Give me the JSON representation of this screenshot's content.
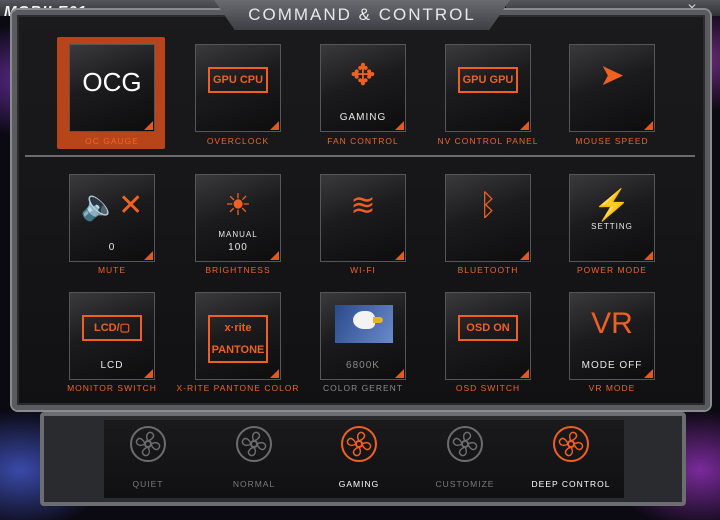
{
  "window": {
    "title": "COMMAND & CONTROL",
    "watermark": "MOBILE01",
    "minimize": "—",
    "close": "✕"
  },
  "tiles": [
    {
      "id": "oc-gauge",
      "label": "OC GAUGE",
      "sub": "",
      "glyph": "OCG",
      "selected": true
    },
    {
      "id": "overclock",
      "label": "OVERCLOCK",
      "sub": "",
      "glyph": "GPU CPU"
    },
    {
      "id": "fan-control",
      "label": "FAN CONTROL",
      "sub": "GAMING",
      "glyph": "✥"
    },
    {
      "id": "nv-control-panel",
      "label": "NV CONTROL PANEL",
      "sub": "",
      "glyph": "GPU GPU"
    },
    {
      "id": "mouse-speed",
      "label": "MOUSE SPEED",
      "sub": "",
      "glyph": "➤"
    },
    {
      "id": "mute",
      "label": "MUTE",
      "sub": "0",
      "glyph": "🔈✕"
    },
    {
      "id": "brightness",
      "label": "BRIGHTNESS",
      "sub": "100",
      "sub2": "MANUAL",
      "glyph": "☀"
    },
    {
      "id": "wifi",
      "label": "WI-FI",
      "sub": "",
      "glyph": "≋"
    },
    {
      "id": "bluetooth",
      "label": "BLUETOOTH",
      "sub": "",
      "glyph": "ᛒ"
    },
    {
      "id": "power-mode",
      "label": "POWER MODE",
      "sub": "",
      "mid": "SETTING",
      "glyph": "⚡"
    },
    {
      "id": "monitor-switch",
      "label": "MONITOR SWITCH",
      "sub": "LCD",
      "glyph": "LCD/▢"
    },
    {
      "id": "xrite-pantone-color",
      "label": "X-RITE PANTONE COLOR",
      "sub": "",
      "glyph": "x·rite PANTONE"
    },
    {
      "id": "color-gerent",
      "label": "COLOR GERENT",
      "sub": "6800K",
      "glyph": ""
    },
    {
      "id": "osd-switch",
      "label": "OSD SWITCH",
      "sub": "",
      "glyph": "OSD ON"
    },
    {
      "id": "vr-mode",
      "label": "VR MODE",
      "sub": "MODE OFF",
      "glyph": "VR"
    }
  ],
  "modes": [
    {
      "id": "quiet",
      "label": "QUIET",
      "active": false
    },
    {
      "id": "normal",
      "label": "NORMAL",
      "active": false
    },
    {
      "id": "gaming",
      "label": "GAMING",
      "active": true
    },
    {
      "id": "customize",
      "label": "CUSTOMIZE",
      "active": false
    },
    {
      "id": "deep-control",
      "label": "DEEP CONTROL",
      "active": true
    }
  ],
  "colors": {
    "accent": "#f06020",
    "label": "#f06428",
    "inactive": "#6c6c70",
    "active_text": "#ffffff"
  }
}
